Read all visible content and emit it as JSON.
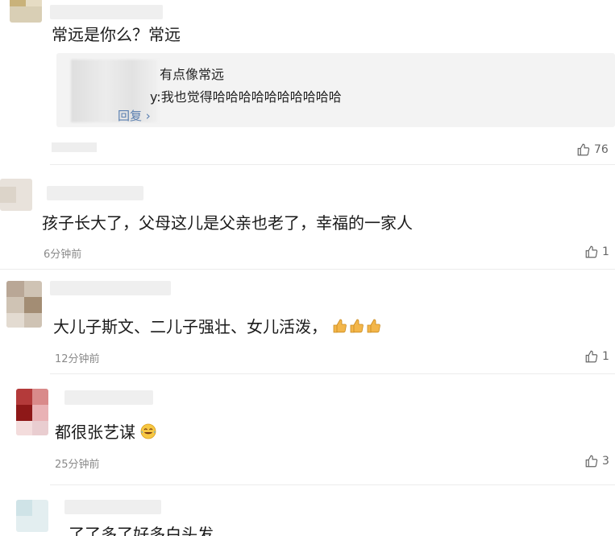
{
  "comments": [
    {
      "text": "常远是你么？常远",
      "time": "",
      "likes": "76",
      "replies": {
        "lines": [
          "有点像常远",
          "y:我也觉得哈哈哈哈哈哈哈哈哈哈"
        ],
        "view_more": "回复"
      }
    },
    {
      "text": "孩子长大了，父母这儿是父亲也老了，幸福的一家人",
      "time": "6分钟前",
      "likes": "1"
    },
    {
      "text": "大儿子斯文、二儿子强壮、女儿活泼，",
      "time": "12分钟前",
      "likes": "1",
      "emoji": "thumbs-up-x3"
    },
    {
      "text": "都很张艺谋",
      "time": "25分钟前",
      "likes": "3",
      "emoji": "laughing-tears"
    },
    {
      "text": "...了了多了好多白头发",
      "time": "",
      "likes": ""
    }
  ],
  "colors": {
    "like_icon": "#666666",
    "reply_link": "#5a7fb0",
    "reply_bg": "#f3f3f3"
  }
}
